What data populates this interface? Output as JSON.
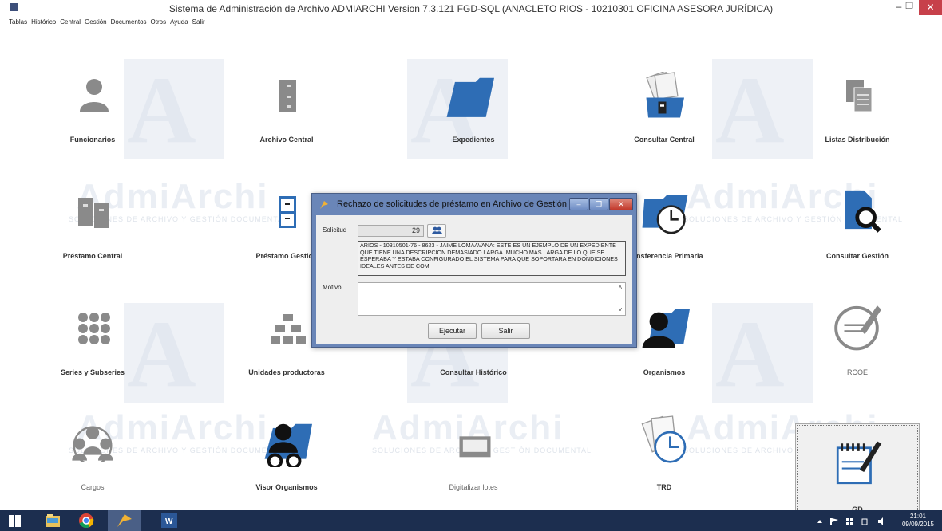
{
  "window": {
    "title": "Sistema de Administración de Archivo ADMIARCHI Version 7.3.121 FGD-SQL (ANACLETO RIOS - 10210301 OFICINA ASESORA JURÍDICA)",
    "minimize": "–",
    "maximize": "❐",
    "close": "✕"
  },
  "menu": [
    "Tablas",
    "Histórico",
    "Central",
    "Gestión",
    "Documentos",
    "Otros",
    "Ayuda",
    "Salir"
  ],
  "watermark": {
    "brand": "AdmiArchi",
    "tagline": "SOLUCIONES DE ARCHIVO Y GESTIÓN DOCUMENTAL",
    "letters": "A"
  },
  "tiles": [
    {
      "label": "Funcionarios",
      "icon": "person-icon"
    },
    {
      "label": "Archivo Central",
      "icon": "cabinet-icon"
    },
    {
      "label": "Expedientes",
      "icon": "folder-icon"
    },
    {
      "label": "Consultar Central",
      "icon": "folder-search-icon"
    },
    {
      "label": "Listas Distribución",
      "icon": "documents-icon"
    },
    {
      "label": "Préstamo Central",
      "icon": "cabinet-loan-icon"
    },
    {
      "label": "Préstamo Gestión",
      "icon": "cabinet-small-icon"
    },
    {
      "label": "Transferencia Primaria",
      "icon": "folder-clock-icon"
    },
    {
      "label": "Consultar Gestión",
      "icon": "document-search-icon"
    },
    {
      "label": "Series y Subseries",
      "icon": "grid-dots-icon"
    },
    {
      "label": "Unidades productoras",
      "icon": "org-chart-icon"
    },
    {
      "label": "Consultar Histórico",
      "icon": "history-icon"
    },
    {
      "label": "Organismos",
      "icon": "folder-person-icon"
    },
    {
      "label": "RCOE",
      "icon": "edit-note-icon"
    },
    {
      "label": "Cargos",
      "icon": "group-icon"
    },
    {
      "label": "Visor Organismos",
      "icon": "viewer-icon"
    },
    {
      "label": "Digitalizar lotes",
      "icon": "scanner-icon"
    },
    {
      "label": "TRD",
      "icon": "documents-clock-icon"
    },
    {
      "label": "GD",
      "icon": "notepad-pen-icon"
    }
  ],
  "dialog": {
    "title": "Rechazo de solicitudes de préstamo en Archivo de Gestión",
    "solicitud_label": "Solicitud",
    "solicitud_value": "29",
    "description": "ARIOS - 10310501-76 - 8623 - JAIME LOMAAVANA: ESTE ES UN EJEMPLO DE UN EXPEDIENTE QUE TIENE UNA DESCRIPCION DEMASIADO LARGA. MUCHO MAS LARGA DE LO QUE SE ESPERABA Y ESTABA CONFIGURADO EL SISTEMA PARA QUE SOPORTARA EN DONDICIONES IDEALES ANTES DE COM",
    "motivo_label": "Motivo",
    "motivo_value": "",
    "ejecutar_label": "Ejecutar",
    "salir_label": "Salir"
  },
  "taskbar": {
    "time": "21:01",
    "date": "09/09/2015",
    "apps": [
      "windows-start-icon",
      "file-explorer-icon",
      "chrome-icon",
      "admiarchi-icon",
      "word-icon"
    ]
  },
  "colors": {
    "folder_blue": "#2e6db5",
    "icon_gray": "#8a8a8a",
    "dialog_frame": "#6a86b8",
    "taskbar": "#1c2e4f"
  }
}
